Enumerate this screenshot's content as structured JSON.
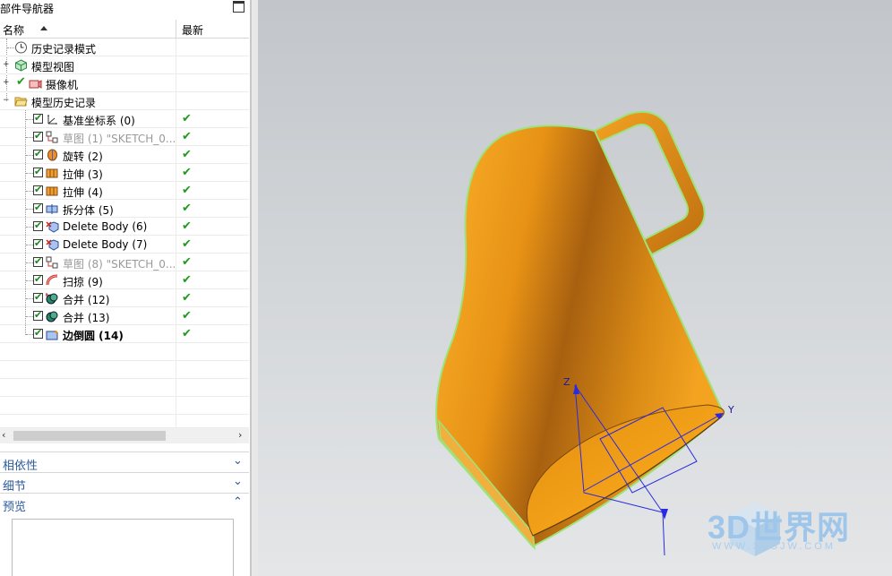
{
  "navigator": {
    "title": "部件导航器",
    "columns": {
      "name": "名称",
      "latest": "最新"
    },
    "tree": [
      {
        "label": "历史记录模式",
        "icon": "clock-icon",
        "style": "normal",
        "latest": ""
      },
      {
        "label": "模型视图",
        "icon": "model-view-icon",
        "style": "normal",
        "latest": ""
      },
      {
        "label": "摄像机",
        "icon": "camera-icon",
        "style": "normal",
        "latest": ""
      },
      {
        "label": "模型历史记录",
        "icon": "folder-open-icon",
        "style": "normal",
        "latest": ""
      },
      {
        "label": "基准坐标系 (0)",
        "icon": "datum-csys-icon",
        "style": "normal",
        "latest": "✔"
      },
      {
        "label": "草图 (1) \"SKETCH_0...",
        "icon": "sketch-icon",
        "style": "dim",
        "latest": "✔"
      },
      {
        "label": "旋转 (2)",
        "icon": "revolve-icon",
        "style": "normal",
        "latest": "✔"
      },
      {
        "label": "拉伸 (3)",
        "icon": "extrude-icon",
        "style": "normal",
        "latest": "✔"
      },
      {
        "label": "拉伸 (4)",
        "icon": "extrude-icon",
        "style": "normal",
        "latest": "✔"
      },
      {
        "label": "拆分体 (5)",
        "icon": "split-body-icon",
        "style": "normal",
        "latest": "✔"
      },
      {
        "label": "Delete Body (6)",
        "icon": "delete-body-icon",
        "style": "normal",
        "latest": "✔"
      },
      {
        "label": "Delete Body (7)",
        "icon": "delete-body-icon",
        "style": "normal",
        "latest": "✔"
      },
      {
        "label": "草图 (8) \"SKETCH_0...",
        "icon": "sketch-icon",
        "style": "dim",
        "latest": "✔"
      },
      {
        "label": "扫掠 (9)",
        "icon": "swept-icon",
        "style": "normal",
        "latest": "✔"
      },
      {
        "label": "合并 (12)",
        "icon": "unite-icon",
        "style": "normal",
        "latest": "✔"
      },
      {
        "label": "合并 (13)",
        "icon": "unite-icon",
        "style": "normal",
        "latest": "✔"
      },
      {
        "label": "边倒圆 (14)",
        "icon": "edge-blend-icon",
        "style": "bold",
        "latest": "✔"
      }
    ],
    "sections": {
      "dependencies": "相依性",
      "details": "细节",
      "preview": "预览"
    }
  },
  "viewport": {
    "axis_labels": {
      "z": "Z",
      "y": "Y"
    },
    "model_color": "#f0a010",
    "edge_color": "#9ee27a",
    "watermark": {
      "text": "3D世界网",
      "sub": "WWW.3DSJW.COM"
    }
  }
}
